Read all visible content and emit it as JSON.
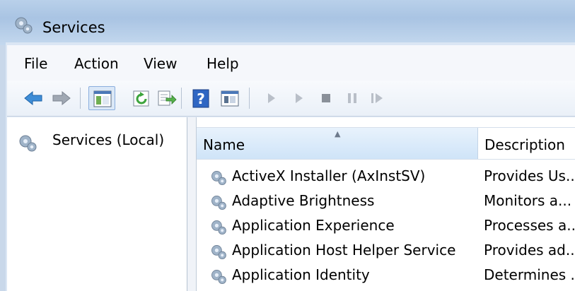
{
  "window": {
    "title": "Services",
    "icon": "gear-icon"
  },
  "menu": [
    "File",
    "Action",
    "View",
    "Help"
  ],
  "toolbar": {
    "buttons": [
      "back-icon",
      "forward-icon",
      "show-hide-tree-icon",
      "refresh-icon",
      "export-list-icon",
      "help-icon",
      "properties-icon",
      "start-icon",
      "start-paused-icon",
      "stop-icon",
      "pause-icon",
      "resume-icon"
    ]
  },
  "tree": {
    "items": [
      {
        "label": "Services (Local)",
        "icon": "gear-icon"
      }
    ]
  },
  "table": {
    "columns": [
      "Name",
      "Description"
    ],
    "sort_column": "Name",
    "rows": [
      {
        "name": "ActiveX Installer (AxInstSV)",
        "description": "Provides Us..."
      },
      {
        "name": "Adaptive Brightness",
        "description": "Monitors a..."
      },
      {
        "name": "Application Experience",
        "description": "Processes a..."
      },
      {
        "name": "Application Host Helper Service",
        "description": "Provides ad..."
      },
      {
        "name": "Application Identity",
        "description": "Determines ..."
      }
    ]
  },
  "colors": {
    "title_bar": "#b9d0ea",
    "header_active": "#d6e8fa",
    "toolbar_arrow": "#3f8dd6"
  }
}
